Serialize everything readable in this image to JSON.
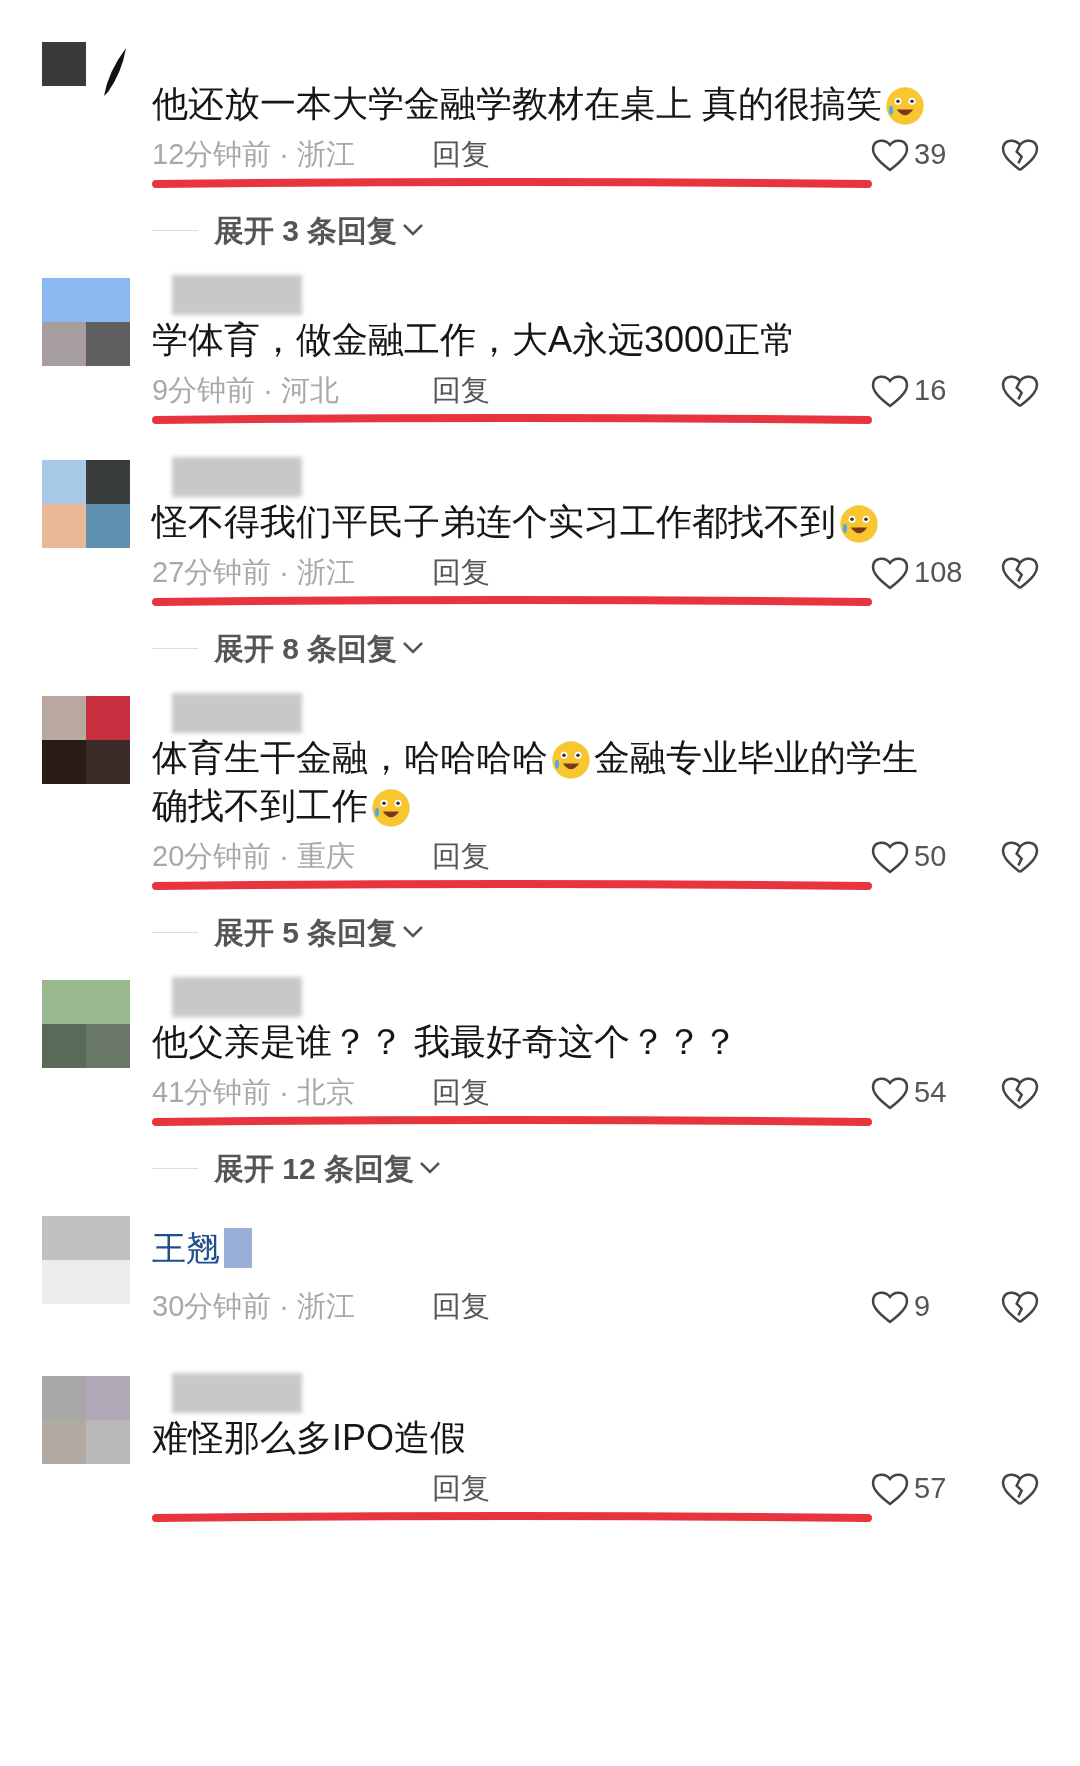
{
  "comments": [
    {
      "name_blurred": false,
      "parts": [
        {
          "kind": "text",
          "text": "他还放一本大学金融学教材在桌上 真的很搞笑"
        },
        {
          "kind": "emoji"
        }
      ],
      "time": "12分钟前 · 浙江",
      "reply": "回复",
      "likes": "39",
      "scribble": true,
      "expand": "展开 3 条回复"
    },
    {
      "name_blurred": true,
      "parts": [
        {
          "kind": "text",
          "text": "学体育，做金融工作，大A永远3000正常"
        }
      ],
      "time": "9分钟前 · 河北",
      "reply": "回复",
      "likes": "16",
      "scribble": true
    },
    {
      "name_blurred": true,
      "parts": [
        {
          "kind": "text",
          "text": "怪不得我们平民子弟连个实习工作都找不到"
        },
        {
          "kind": "emoji"
        }
      ],
      "time": "27分钟前 · 浙江",
      "reply": "回复",
      "likes": "108",
      "scribble": true,
      "expand": "展开 8 条回复"
    },
    {
      "name_blurred": true,
      "parts": [
        {
          "kind": "text",
          "text": "体育生干金融，哈哈哈哈"
        },
        {
          "kind": "emoji"
        },
        {
          "kind": "text",
          "text": "金融专业毕业的学生确找不到工作"
        },
        {
          "kind": "emoji"
        }
      ],
      "time": "20分钟前 · 重庆",
      "reply": "回复",
      "likes": "50",
      "scribble": true,
      "expand": "展开 5 条回复"
    },
    {
      "name_blurred": true,
      "parts": [
        {
          "kind": "text",
          "text": "他父亲是谁？？ 我最好奇这个？？？"
        }
      ],
      "time": "41分钟前 · 北京",
      "reply": "回复",
      "likes": "54",
      "scribble": true,
      "expand": "展开 12 条回复"
    },
    {
      "name": "王翘",
      "name_blurred": true,
      "time": "30分钟前 · 浙江",
      "reply": "回复",
      "likes": "9",
      "scribble": false
    },
    {
      "name_blurred": true,
      "parts": [
        {
          "kind": "text",
          "text": "难怪那么多IPO造假"
        }
      ],
      "reply": "回复",
      "likes": "57",
      "scribble": true
    }
  ]
}
